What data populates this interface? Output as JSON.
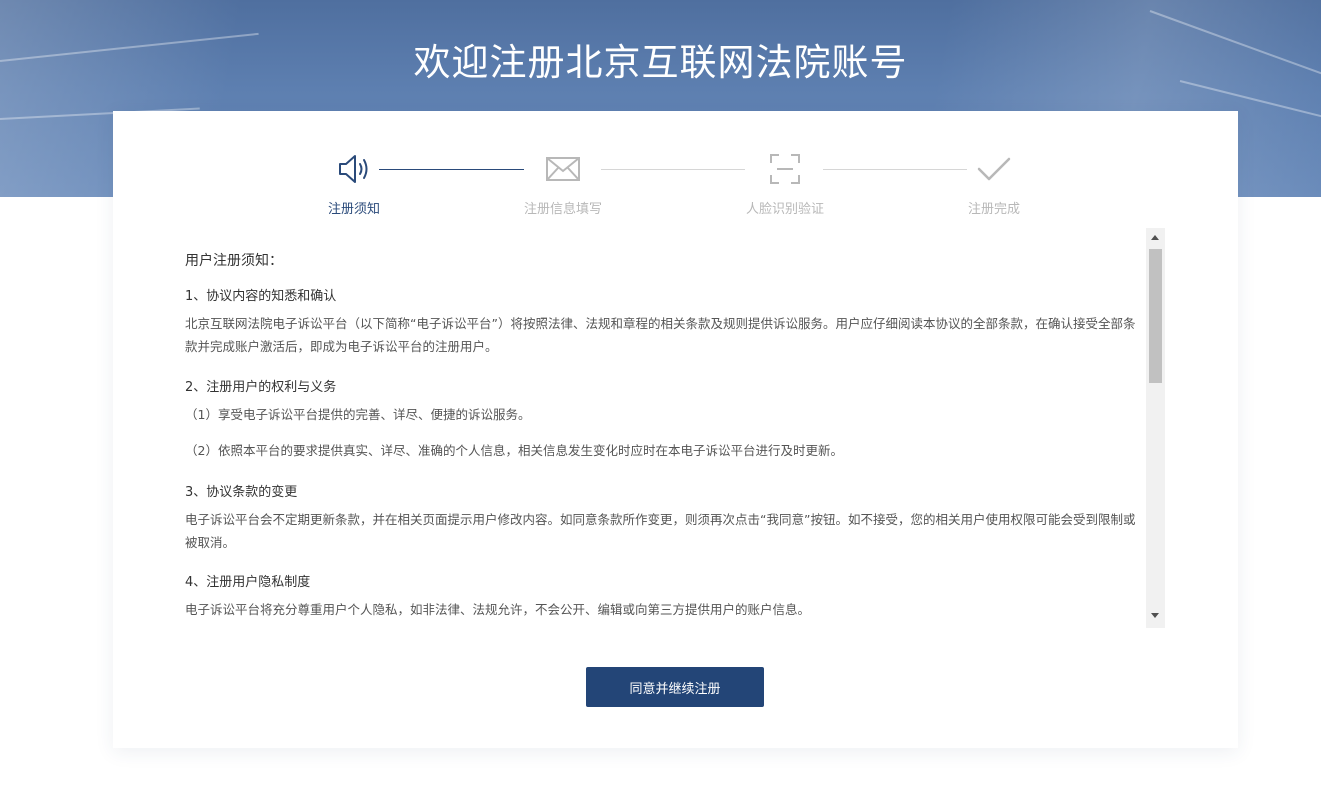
{
  "page": {
    "title": "欢迎注册北京互联网法院账号"
  },
  "colors": {
    "primary": "#234577",
    "step_active": "#2a4a7a",
    "step_inactive": "#b8b8b8"
  },
  "steps": [
    {
      "label": "注册须知",
      "icon": "speaker-icon",
      "state": "active"
    },
    {
      "label": "注册信息填写",
      "icon": "envelope-icon",
      "state": "inactive"
    },
    {
      "label": "人脸识别验证",
      "icon": "face-scan-icon",
      "state": "inactive"
    },
    {
      "label": "注册完成",
      "icon": "checkmark-icon",
      "state": "inactive"
    }
  ],
  "notice": {
    "heading": "用户注册须知：",
    "sections": [
      {
        "title": "1、协议内容的知悉和确认",
        "paragraphs": [
          "北京互联网法院电子诉讼平台（以下简称“电子诉讼平台”）将按照法律、法规和章程的相关条款及规则提供诉讼服务。用户应仔细阅读本协议的全部条款，在确认接受全部条款并完成账户激活后，即成为电子诉讼平台的注册用户。"
        ]
      },
      {
        "title": "2、注册用户的权利与义务",
        "paragraphs": [
          "（1）享受电子诉讼平台提供的完善、详尽、便捷的诉讼服务。",
          "（2）依照本平台的要求提供真实、详尽、准确的个人信息，相关信息发生变化时应时在本电子诉讼平台进行及时更新。"
        ]
      },
      {
        "title": "3、协议条款的变更",
        "paragraphs": [
          "电子诉讼平台会不定期更新条款，并在相关页面提示用户修改内容。如同意条款所作变更，则须再次点击“我同意”按钮。如不接受，您的相关用户使用权限可能会受到限制或被取消。"
        ]
      },
      {
        "title": "4、注册用户隐私制度",
        "paragraphs": [
          "电子诉讼平台将充分尊重用户个人隐私，如非法律、法规允许，不会公开、编辑或向第三方提供用户的账户信息。"
        ]
      }
    ]
  },
  "actions": {
    "agree_label": "同意并继续注册"
  }
}
